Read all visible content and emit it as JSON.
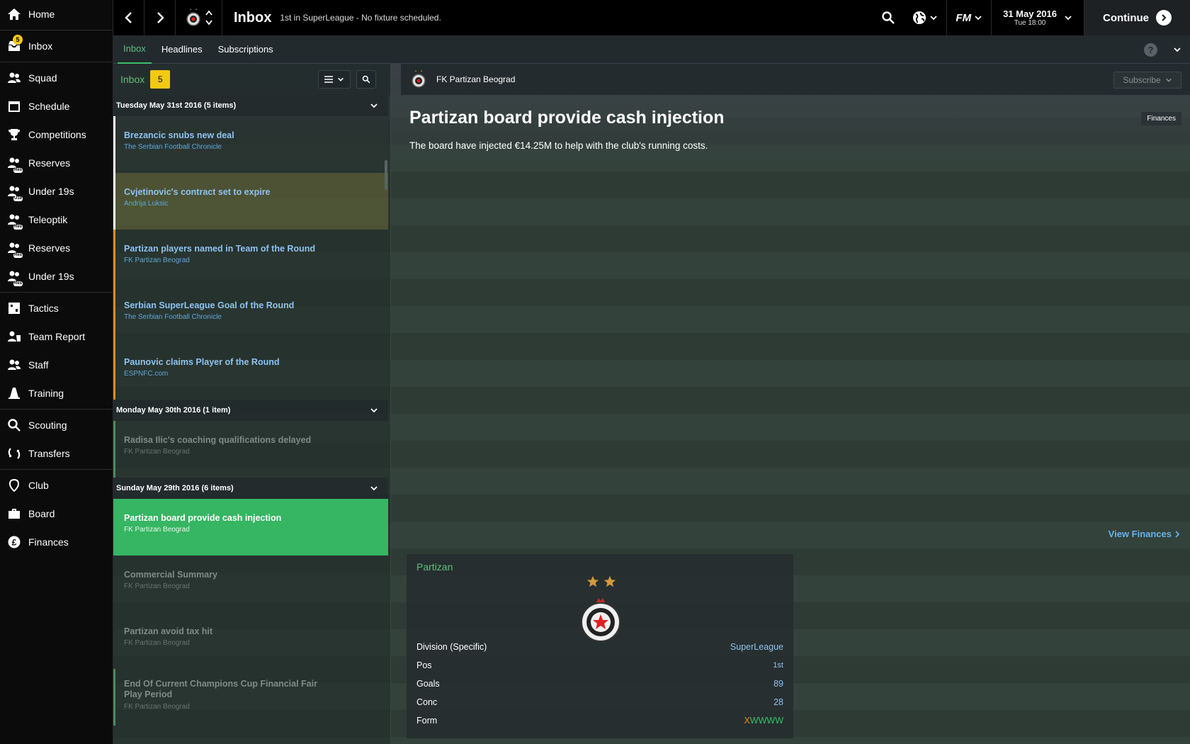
{
  "sidebar": {
    "items": [
      {
        "label": "Home"
      },
      {
        "label": "Inbox",
        "badge": "5"
      },
      {
        "label": "Squad"
      },
      {
        "label": "Schedule"
      },
      {
        "label": "Competitions"
      },
      {
        "label": "Reserves",
        "tag": "Res"
      },
      {
        "label": "Under 19s",
        "tag": "U19"
      },
      {
        "label": "Teleoptik",
        "tag": "Res"
      },
      {
        "label": "Reserves",
        "tag": "Res"
      },
      {
        "label": "Under 19s",
        "tag": "Res"
      },
      {
        "label": "Tactics"
      },
      {
        "label": "Team Report"
      },
      {
        "label": "Staff"
      },
      {
        "label": "Training"
      },
      {
        "label": "Scouting"
      },
      {
        "label": "Transfers"
      },
      {
        "label": "Club"
      },
      {
        "label": "Board"
      },
      {
        "label": "Finances"
      }
    ]
  },
  "topbar": {
    "title": "Inbox",
    "subtitle": "1st in SuperLeague - No fixture scheduled.",
    "fm_logo": "FM",
    "date": "31 May 2016",
    "time": "Tue 18:00",
    "continue_label": "Continue"
  },
  "tabs": [
    "Inbox",
    "Headlines",
    "Subscriptions"
  ],
  "help_label": "?",
  "inbox": {
    "title": "Inbox",
    "count": "5",
    "days": [
      {
        "label": "Tuesday May 31st 2016 (5 items)",
        "messages": [
          {
            "title": "Brezancic snubs new deal",
            "from": "The Serbian Football Chronicle"
          },
          {
            "title": "Cvjetinovic's contract set to expire",
            "from": "Andrija Luksic"
          },
          {
            "title": "Partizan players named in Team of the Round",
            "from": "FK Partizan Beograd"
          },
          {
            "title": "Serbian SuperLeague Goal of the Round",
            "from": "The Serbian Football Chronicle"
          },
          {
            "title": "Paunovic claims Player of the Round",
            "from": "ESPNFC.com"
          }
        ]
      },
      {
        "label": "Monday May 30th 2016 (1 item)",
        "messages": [
          {
            "title": "Radisa Ilic's coaching qualifications delayed",
            "from": "FK Partizan Beograd"
          }
        ]
      },
      {
        "label": "Sunday May 29th 2016 (6 items)",
        "messages": [
          {
            "title": "Partizan board provide cash injection",
            "from": "FK Partizan Beograd"
          },
          {
            "title": "Commercial Summary",
            "from": "FK Partizan Beograd"
          },
          {
            "title": "Partizan avoid tax hit",
            "from": "FK Partizan Beograd"
          },
          {
            "title": "End Of Current Champions Cup Financial Fair Play Period",
            "from": "FK Partizan Beograd"
          }
        ]
      }
    ]
  },
  "detail": {
    "sender": "FK Partizan Beograd",
    "subscribe_label": "Subscribe",
    "title": "Partizan board provide cash injection",
    "tag": "Finances",
    "body": "The board have injected €14.25M to help with the club's running costs.",
    "view_link": "View Finances",
    "card": {
      "name": "Partizan",
      "rows": [
        {
          "label": "Division (Specific)",
          "value": "SuperLeague"
        },
        {
          "label": "Pos",
          "value": "1st"
        },
        {
          "label": "Goals",
          "value": "89"
        },
        {
          "label": "Conc",
          "value": "28"
        }
      ],
      "form_label": "Form",
      "form_first": "X",
      "form_rest": "WWWW"
    }
  },
  "colors": {
    "accent_green": "#3bbf6a",
    "link_blue": "#8ec3ef",
    "badge_yellow": "#f2c913",
    "form_loss": "#f28a1c"
  }
}
